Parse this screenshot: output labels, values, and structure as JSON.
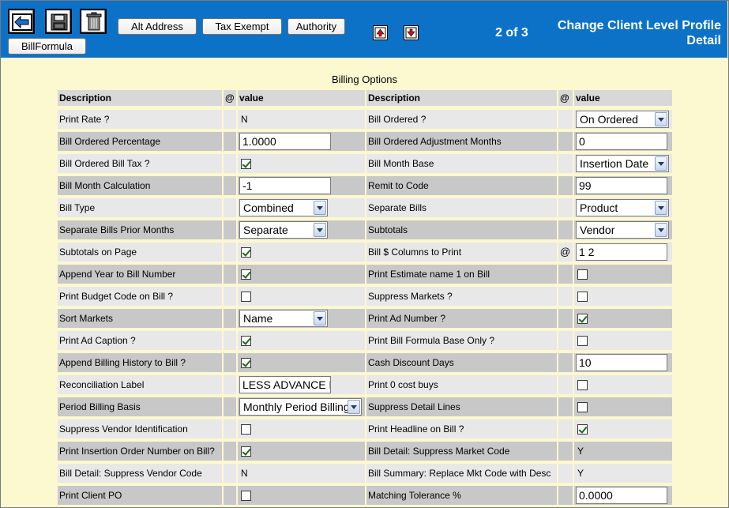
{
  "header": {
    "page_counter": "2 of 3",
    "title_line1": "Change Client Level Profile",
    "title_line2": "Detail",
    "buttons": {
      "alt_address": "Alt Address",
      "tax_exempt": "Tax Exempt",
      "authority": "Authority",
      "bill_formula": "BillFormula"
    }
  },
  "section_title": "Billing Options",
  "columns": {
    "description": "Description",
    "at": "@",
    "value": "value"
  },
  "rows": [
    {
      "l": {
        "label": "Print Rate ?",
        "type": "text",
        "value": "N"
      },
      "r": {
        "label": "Bill Ordered ?",
        "type": "select",
        "value": "On Ordered"
      }
    },
    {
      "l": {
        "label": "Bill Ordered Percentage",
        "type": "input",
        "value": "1.0000"
      },
      "r": {
        "label": "Bill Ordered Adjustment Months",
        "type": "input",
        "value": "0"
      }
    },
    {
      "l": {
        "label": "Bill Ordered Bill Tax ?",
        "type": "check",
        "checked": true
      },
      "r": {
        "label": "Bill Month Base",
        "type": "select",
        "value": "Insertion Date"
      }
    },
    {
      "l": {
        "label": "Bill Month Calculation",
        "type": "input",
        "value": "-1"
      },
      "r": {
        "label": "Remit to Code",
        "type": "input",
        "value": "99"
      }
    },
    {
      "l": {
        "label": "Bill Type",
        "type": "select",
        "value": "Combined"
      },
      "r": {
        "label": "Separate Bills",
        "type": "select",
        "value": "Product"
      }
    },
    {
      "l": {
        "label": "Separate Bills Prior Months",
        "type": "select",
        "value": "Separate"
      },
      "r": {
        "label": "Subtotals",
        "type": "select",
        "value": "Vendor"
      }
    },
    {
      "l": {
        "label": "Subtotals on Page",
        "type": "check",
        "checked": true
      },
      "r": {
        "label": "Bill $ Columns to Print",
        "type": "input",
        "value": "1 2",
        "at": "@"
      }
    },
    {
      "l": {
        "label": "Append Year to Bill Number",
        "type": "check",
        "checked": true
      },
      "r": {
        "label": "Print Estimate name 1 on Bill",
        "type": "check",
        "checked": false
      }
    },
    {
      "l": {
        "label": "Print Budget Code on Bill ?",
        "type": "check",
        "checked": false
      },
      "r": {
        "label": "Suppress Markets ?",
        "type": "check",
        "checked": false
      }
    },
    {
      "l": {
        "label": "Sort Markets",
        "type": "select",
        "value": "Name"
      },
      "r": {
        "label": "Print Ad Number ?",
        "type": "check",
        "checked": true
      }
    },
    {
      "l": {
        "label": "Print Ad Caption ?",
        "type": "check",
        "checked": true
      },
      "r": {
        "label": "Print Bill Formula Base Only ?",
        "type": "check",
        "checked": false
      }
    },
    {
      "l": {
        "label": "Append Billing History to Bill ?",
        "type": "check",
        "checked": true
      },
      "r": {
        "label": "Cash Discount Days",
        "type": "input",
        "value": "10"
      }
    },
    {
      "l": {
        "label": "Reconciliation Label",
        "type": "input",
        "value": "LESS ADVANCE BI"
      },
      "r": {
        "label": "Print 0 cost buys",
        "type": "check",
        "checked": false
      }
    },
    {
      "l": {
        "label": "Period Billing Basis",
        "type": "select",
        "value": "Monthly Period Billing",
        "wide": true
      },
      "r": {
        "label": "Suppress Detail Lines",
        "type": "check",
        "checked": false
      }
    },
    {
      "l": {
        "label": "Suppress Vendor Identification",
        "type": "check",
        "checked": false
      },
      "r": {
        "label": "Print Headline on Bill ?",
        "type": "check",
        "checked": true
      }
    },
    {
      "l": {
        "label": "Print Insertion Order Number on Bill?",
        "type": "check",
        "checked": true
      },
      "r": {
        "label": "Bill Detail: Suppress Market Code",
        "type": "text",
        "value": "Y"
      }
    },
    {
      "l": {
        "label": "Bill Detail: Suppress Vendor Code",
        "type": "text",
        "value": "N"
      },
      "r": {
        "label": "Bill Summary: Replace Mkt Code with Desc",
        "type": "text",
        "value": "Y"
      }
    },
    {
      "l": {
        "label": "Print Client PO",
        "type": "check",
        "checked": false
      },
      "r": {
        "label": "Matching Tolerance %",
        "type": "input",
        "value": "0.0000"
      }
    }
  ]
}
